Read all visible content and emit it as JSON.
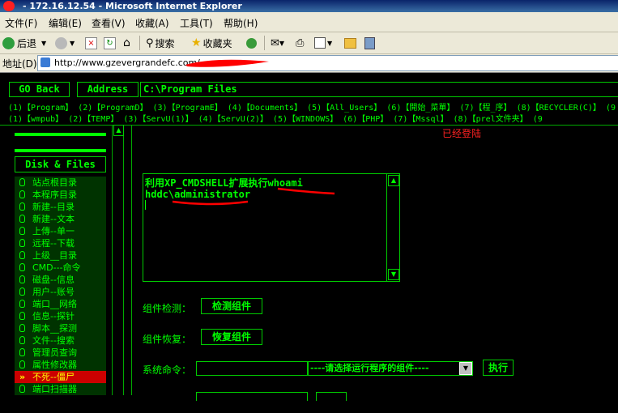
{
  "window": {
    "title": "- 172.16.12.54 - Microsoft Internet Explorer"
  },
  "menu": [
    "文件(F)",
    "编辑(E)",
    "查看(V)",
    "收藏(A)",
    "工具(T)",
    "帮助(H)"
  ],
  "toolbar": {
    "back": "后退",
    "search": "搜索",
    "favorites": "收藏夹"
  },
  "address": {
    "label": "地址(D)",
    "url": "http://www.gzevergrandefc.com/"
  },
  "top": {
    "goback": "GO Back",
    "address": "Address",
    "path": "C:\\Program Files"
  },
  "paths_row1": [
    "(1)【Program】",
    "(2)【ProgramD】",
    "(3)【ProgramE】",
    "(4)【Documents】",
    "(5)【All_Users】",
    "(6)【開始_菜單】",
    "(7)【程_序】",
    "(8)【RECYCLER(C)】",
    "(9"
  ],
  "paths_row2": [
    "(1)【wmpub】",
    "(2)【TEMP】",
    "(3)【ServU(1)】",
    "(4)【ServU(2)】",
    "(5)【WINDOWS】",
    "(6)【PHP】",
    "(7)【Mssql】",
    "(8)【prel文件夹】",
    "(9"
  ],
  "sidebar": {
    "header": "Disk & Files",
    "items": [
      "站点根目录",
      "本程序目录",
      "新建--目录",
      "新建--文本",
      "上傳--单一",
      "远程--下载",
      "上级__目录",
      "CMD---命令",
      "磁盘--信息",
      "用户--账号",
      "端口__网络",
      "信息--探针",
      "脚本__探测",
      "文件--搜索",
      "管理员查询",
      "属性修改器",
      "不死--僵尸",
      "端口扫描器"
    ]
  },
  "status": {
    "logged_in": "已经登陆"
  },
  "output": {
    "line1": "利用XP_CMDSHELL扩展执行whoami",
    "line2": "hddc\\administrator"
  },
  "form": {
    "detect_label": "组件检测：",
    "detect_btn": "检测组件",
    "restore_label": "组件恢复：",
    "restore_btn": "恢复组件",
    "cmd_label": "系统命令：",
    "select_value": "----请选择运行程序的组件----",
    "exec_btn": "执行"
  },
  "colors": {
    "accent": "#00ff00",
    "status_red": "#ff2222",
    "active_item": "#cc0000"
  }
}
